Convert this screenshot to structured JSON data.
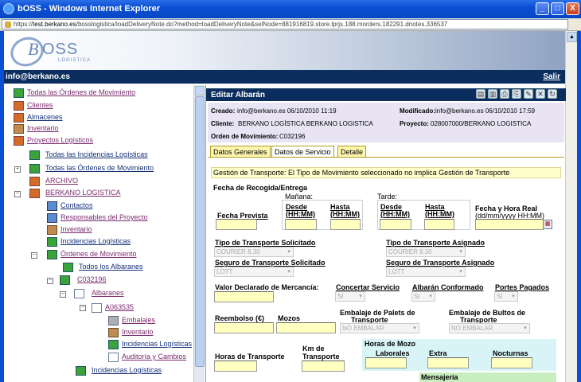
{
  "window": {
    "title": "bOSS - Windows Internet Explorer",
    "url_prefix": "https://",
    "url_host": "test.berkano.es",
    "url_rest": "/bosslogistica/loadDeliveryNote.do?method=loadDeliveryNote&selNode=881916819.store.lprjs.188.morders.182291.dnotes.336537",
    "minimize_glyph": "_",
    "maximize_glyph": "□",
    "close_glyph": "X"
  },
  "logo": {
    "brand": "BOSS",
    "letter": "B",
    "rest": "OSS",
    "tagline": "LOGISTICA"
  },
  "userbar": {
    "email": "info@berkano.es",
    "logout": "Salir"
  },
  "sidebar": {
    "items": [
      {
        "label": "Todas las Órdenes de Movimiento",
        "icon": "documents-arrow-icon"
      },
      {
        "label": "Clientes",
        "icon": "people-icon"
      },
      {
        "label": "Almacenes",
        "icon": "warehouse-icon"
      },
      {
        "label": "Inventario",
        "icon": "inventory-icon"
      },
      {
        "label": "Proyectos Logísticos",
        "icon": "projects-icon"
      },
      {
        "label": "Todas las Incidencias Logísticas",
        "icon": "incidents-icon"
      },
      {
        "label": "Todas las Órdenes de Movimiento",
        "icon": "documents-arrow-icon"
      },
      {
        "label": "ARCHIVO",
        "icon": "archive-icon"
      },
      {
        "label": "BERKANO LOGISTICA",
        "icon": "project-icon"
      },
      {
        "label": "Contactos",
        "icon": "contacts-icon"
      },
      {
        "label": "Responsables del Proyecto",
        "icon": "managers-icon"
      },
      {
        "label": "Inventario",
        "icon": "inventory-icon"
      },
      {
        "label": "Incidencias Logísticas",
        "icon": "incidents-icon"
      },
      {
        "label": "Órdenes de Movimiento",
        "icon": "orders-icon"
      },
      {
        "label": "Todos los Albaranes",
        "icon": "delivery-notes-icon"
      },
      {
        "label": "C032196",
        "icon": "order-icon"
      },
      {
        "label": "Albaranes",
        "icon": "delivery-notes-icon"
      },
      {
        "label": "A063535",
        "icon": "delivery-note-icon"
      },
      {
        "label": "Embalajes",
        "icon": "packaging-icon"
      },
      {
        "label": "Inventario",
        "icon": "inventory-icon"
      },
      {
        "label": "Incidencias Logísticas",
        "icon": "incidents-icon"
      },
      {
        "label": "Auditoría y Cambios",
        "icon": "audit-icon"
      },
      {
        "label": "Incidencias Logísticas",
        "icon": "incidents-icon"
      }
    ],
    "toggle_minus": "−",
    "toggle_plus": "+"
  },
  "main": {
    "title": "Editar Albarán",
    "toolbar_glyphs": [
      "▤",
      "▥",
      "⎙",
      "⎘",
      "✎",
      "✕",
      "↻"
    ],
    "info": {
      "creado_label": "Creado:",
      "creado_value": "info@berkano.es   06/10/2010 11:19",
      "modificado_label": "Modificado:",
      "modificado_value": "info@berkano.es   06/10/2010 17:59",
      "cliente_label": "Cliente:",
      "cliente_value": "BERKANO LOGÍSTICA  BERKANO LOGISTICA",
      "proyecto_label": "Proyecto:",
      "proyecto_value": "028007000/BERKANO LOGISTICA",
      "orden_label": "Orden de Movimiento:",
      "orden_value": "C032196"
    },
    "tabs": [
      "Datos Generales",
      "Datos de Servicio",
      "Detalle"
    ],
    "active_tab": "Datos de Servicio",
    "notice": "Gestión de Transporte: El Tipo de Movimiento seleccionado no implica Gestión de Transporte",
    "form": {
      "fecha_section": "Fecha de Recogida/Entrega",
      "manana": "Mañana:",
      "tarde": "Tarde:",
      "fecha_prevista": "Fecha Prevista",
      "desde_l1": "Desde",
      "desde_l2": "(HH:MM)",
      "hasta_l1": "Hasta",
      "hasta_l2": "(HH:MM)",
      "fecha_real_l1": "Fecha y Hora Real",
      "fecha_real_l2": "(dd/mm/yyyy HH:MM)",
      "calendar_glyph": "▦",
      "tipo_solicitado": "Tipo de Transporte Solicitado",
      "tipo_solicitado_value": "COURIER 8.30",
      "tipo_asignado": "Tipo de Transporte Asignado",
      "tipo_asignado_value": "COURIER 8.30",
      "seguro_solicitado": "Seguro de Transporte Solicitado",
      "seguro_solicitado_value": "LOTT",
      "seguro_asignado": "Seguro de Transporte Asignado",
      "seguro_asignado_value": "LOTT",
      "valor_declarado": "Valor Declarado de Mercancía:",
      "concertar": "Concertar Servicio",
      "concertar_value": "SI",
      "albaran_conformado": "Albarán Conformado",
      "albaran_conformado_value": "SI",
      "portes_pagados": "Portes Pagados",
      "portes_pagados_value": "SI",
      "reembolso": "Reembolso (€)",
      "mozos": "Mozos",
      "embalaje_palets_l1": "Embalaje de Palets de",
      "embalaje_palets_l2": "Transporte",
      "embalaje_palets_value": "NO EMBALAR",
      "embalaje_bultos_l1": "Embalaje de Bultos de",
      "embalaje_bultos_l2": "Transporte",
      "embalaje_bultos_value": "NO EMBALAR",
      "horas_transporte": "Horas de Transporte",
      "km_l1": "Km de",
      "km_l2": "Transporte",
      "horas_mozo": "Horas de Mozo",
      "laborales": "Laborales",
      "extra": "Extra",
      "nocturnas": "Nocturnas",
      "mensajeria": "Mensajería",
      "select_arrow": "▾"
    }
  }
}
